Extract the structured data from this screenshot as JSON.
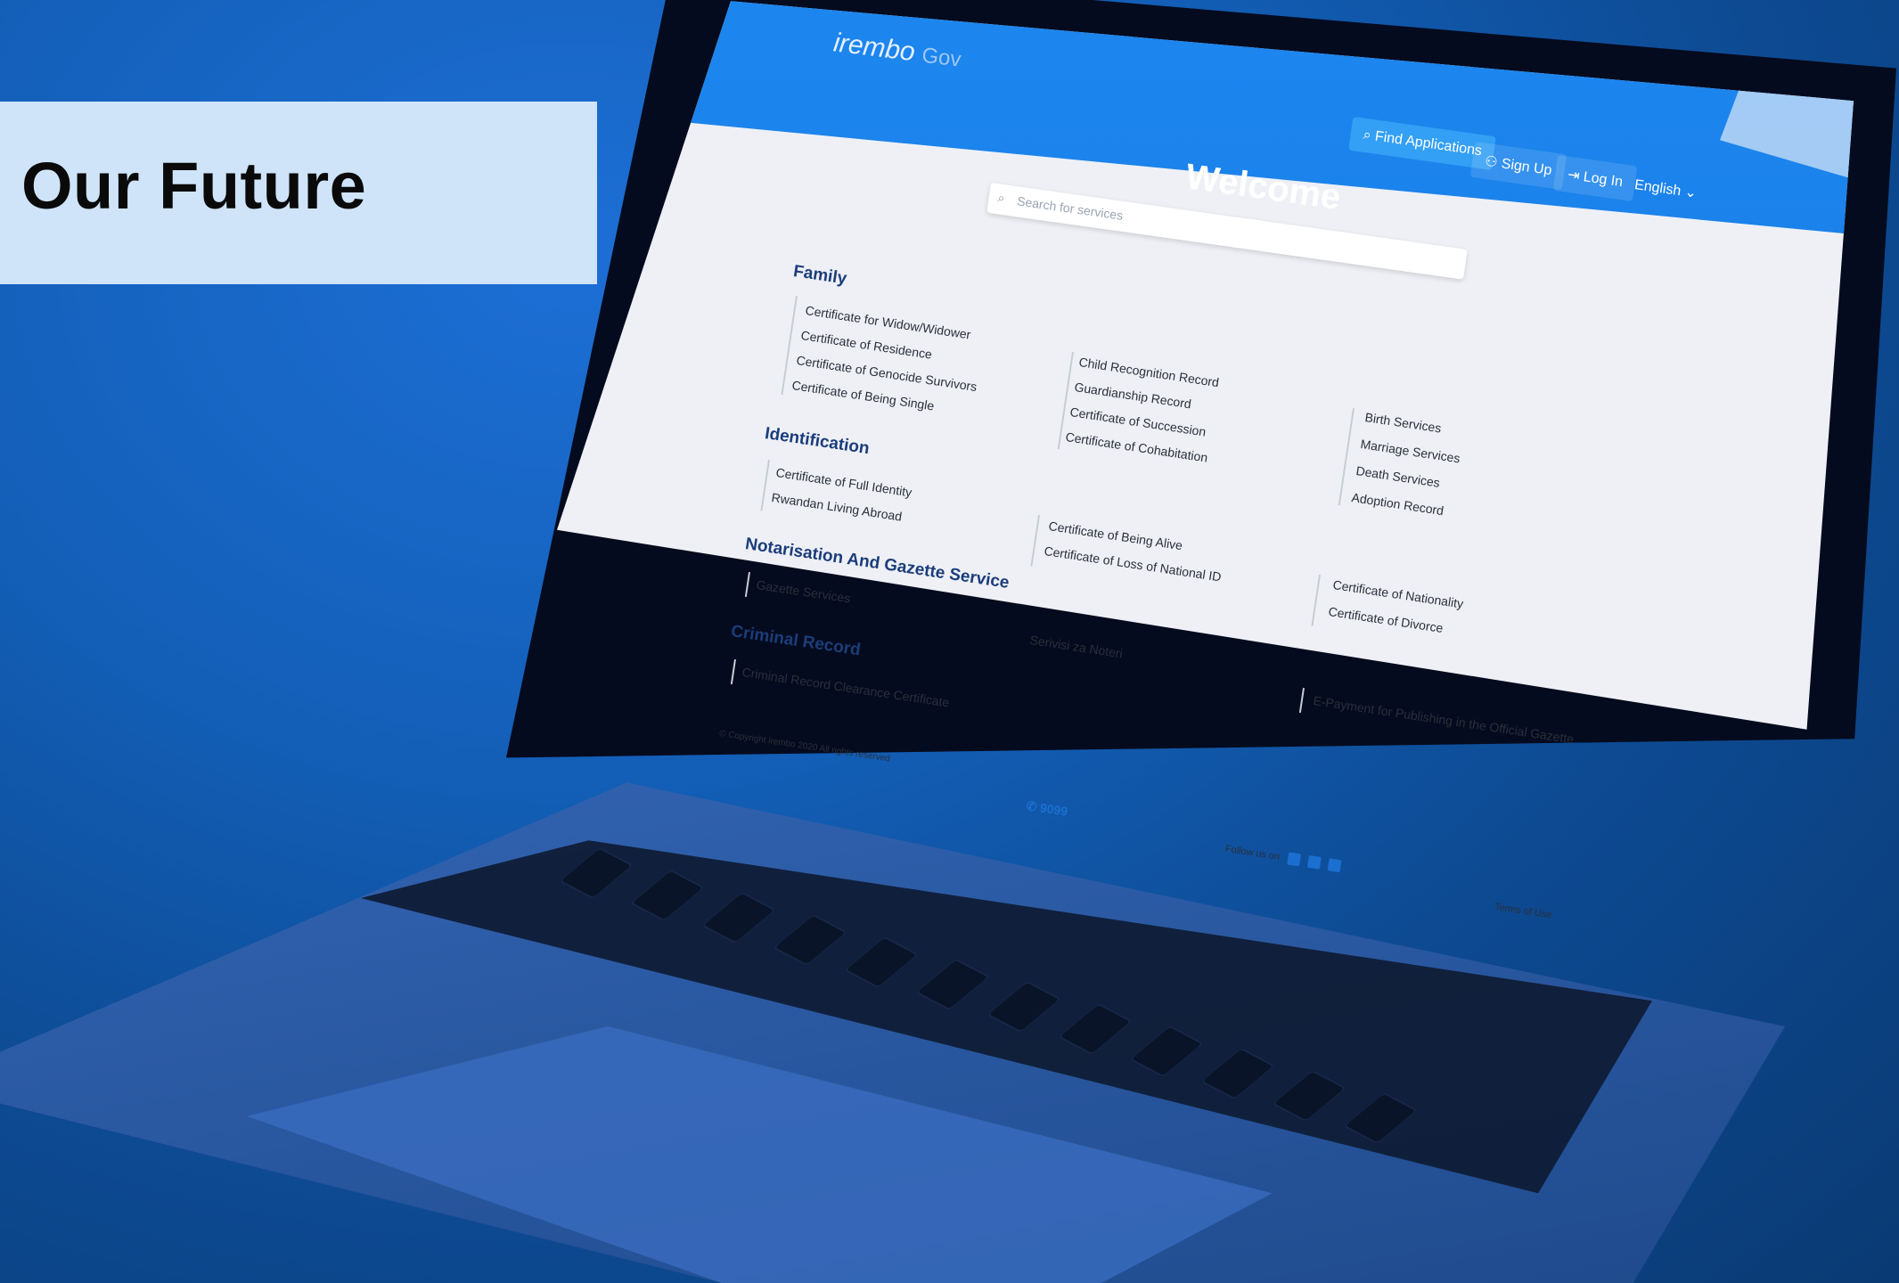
{
  "banner": {
    "title": "Our Future"
  },
  "site": {
    "brand": "irembo",
    "brand_suffix": "Gov",
    "nav": {
      "find_applications": "Find Applications",
      "sign_up": "Sign Up",
      "log_in": "Log In",
      "language": "English"
    },
    "welcome": "Welcome",
    "search": {
      "placeholder": "Search for services"
    },
    "categories": {
      "family": "Family",
      "identification": "Identification",
      "notarisation": "Notarisation And Gazette Service",
      "criminal_record": "Criminal Record"
    },
    "family_items": [
      "Certificate for Widow/Widower",
      "Certificate of Residence",
      "Certificate of Genocide Survivors",
      "Certificate of Being Single"
    ],
    "family_items_col2": [
      "Child Recognition Record",
      "Guardianship Record",
      "Certificate of Succession",
      "Certificate of Cohabitation"
    ],
    "family_items_col3": [
      "Birth Services",
      "Marriage Services",
      "Death Services",
      "Adoption Record"
    ],
    "identification_items": [
      "Certificate of Full Identity",
      "Rwandan Living Abroad"
    ],
    "identification_items_col2": [
      "Certificate of Being Alive",
      "Certificate of Loss of National ID"
    ],
    "identification_items_col3": [
      "Certificate of Nationality",
      "Certificate of Divorce"
    ],
    "notarisation_items": [
      "Gazette Services"
    ],
    "notarisation_items_col2": [
      "Serivisi za Noteri"
    ],
    "criminal_items": [
      "Criminal Record Clearance Certificate"
    ],
    "criminal_items_col3": [
      "E-Payment for Publishing in the Official Gazette"
    ],
    "footer": {
      "copyright": "© Copyright irembo 2020 All rights reserved",
      "phone": "9099",
      "follow": "Follow us on",
      "terms": "Terms of Use"
    }
  },
  "colors": {
    "background": "#135fb8",
    "banner": "#cfe4f8",
    "site_header": "#1c86ef",
    "site_body": "#eef0f6",
    "category": "#1b3d7a"
  },
  "icons": [
    "search-icon",
    "user-add-icon",
    "login-icon",
    "chevron-down-icon",
    "phone-icon",
    "twitter-icon",
    "facebook-icon",
    "linkedin-icon"
  ]
}
